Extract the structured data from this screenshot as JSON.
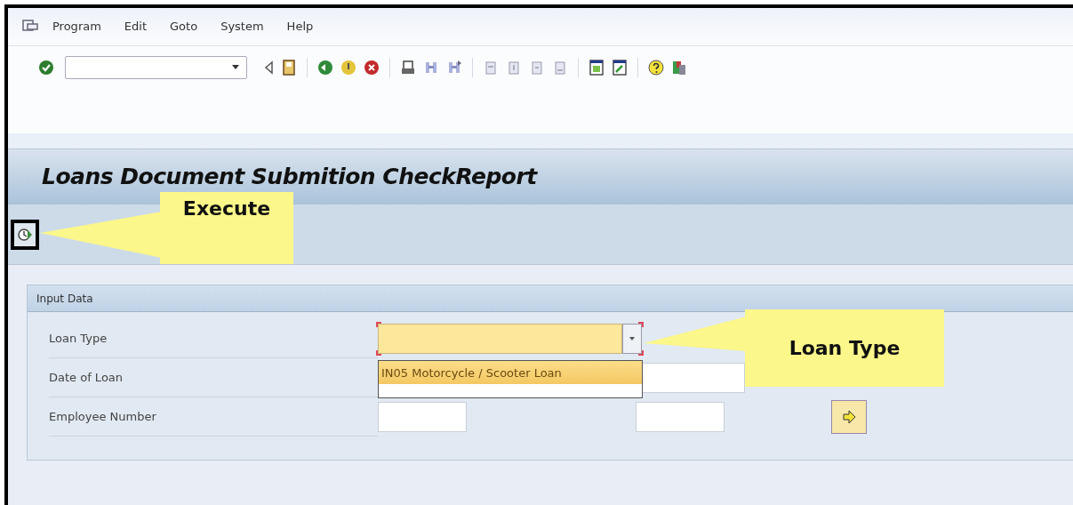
{
  "menu": [
    {
      "label": "Program"
    },
    {
      "label": "Edit"
    },
    {
      "label": "Goto"
    },
    {
      "label": "System"
    },
    {
      "label": "Help"
    }
  ],
  "title": "Loans Document Submition CheckReport",
  "section": {
    "title": "Input Data",
    "rows": [
      {
        "label": "Loan Type",
        "kind": "select",
        "focused": true
      },
      {
        "label": "Date of Loan",
        "kind": "range",
        "from_field": false,
        "to_field": true,
        "more_button": false
      },
      {
        "label": "Employee Number",
        "kind": "range",
        "from_field": true,
        "to_field": true,
        "more_button": true
      }
    ]
  },
  "dropdown": {
    "options": [
      {
        "label": "IN05 Motorcycle / Scooter Loan",
        "selected": true
      }
    ]
  },
  "callouts": [
    {
      "text": "Execute"
    },
    {
      "text": "Loan Type"
    }
  ]
}
